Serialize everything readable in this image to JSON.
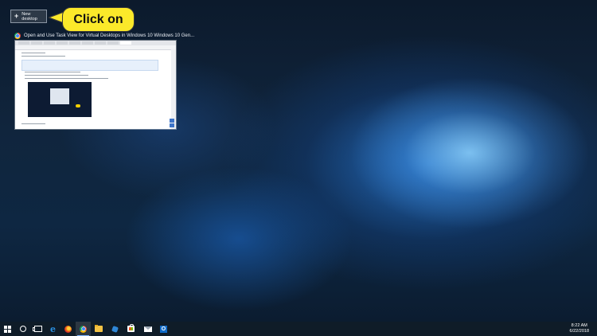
{
  "task_view": {
    "new_desktop_label": "New desktop",
    "new_desktop_icon": "plus-icon"
  },
  "annotation": {
    "callout_text": "Click on",
    "callout_color": "#fbe92a"
  },
  "window": {
    "title": "Open and Use Task View for Virtual Desktops in Windows 10 Windows 10 Gen...",
    "app_icon": "chrome-icon"
  },
  "taskbar": {
    "items": [
      {
        "name": "start-button",
        "icon": "windows-logo-icon"
      },
      {
        "name": "cortana",
        "icon": "cortana-circle-icon"
      },
      {
        "name": "task-view",
        "icon": "task-view-icon"
      },
      {
        "name": "edge",
        "icon": "edge-icon"
      },
      {
        "name": "firefox",
        "icon": "firefox-icon"
      },
      {
        "name": "chrome",
        "icon": "chrome-icon",
        "active": true
      },
      {
        "name": "file-explorer",
        "icon": "folder-icon"
      },
      {
        "name": "app",
        "icon": "app-icon"
      },
      {
        "name": "store",
        "icon": "store-icon"
      },
      {
        "name": "mail",
        "icon": "mail-icon"
      },
      {
        "name": "outlook",
        "icon": "outlook-icon"
      }
    ],
    "clock": {
      "time": "8:22 AM",
      "date": "6/22/2018"
    },
    "background_color": "#0f1c28"
  },
  "colors": {
    "accent": "#3d74c9",
    "taskbar_active": "#7fb6ff"
  }
}
